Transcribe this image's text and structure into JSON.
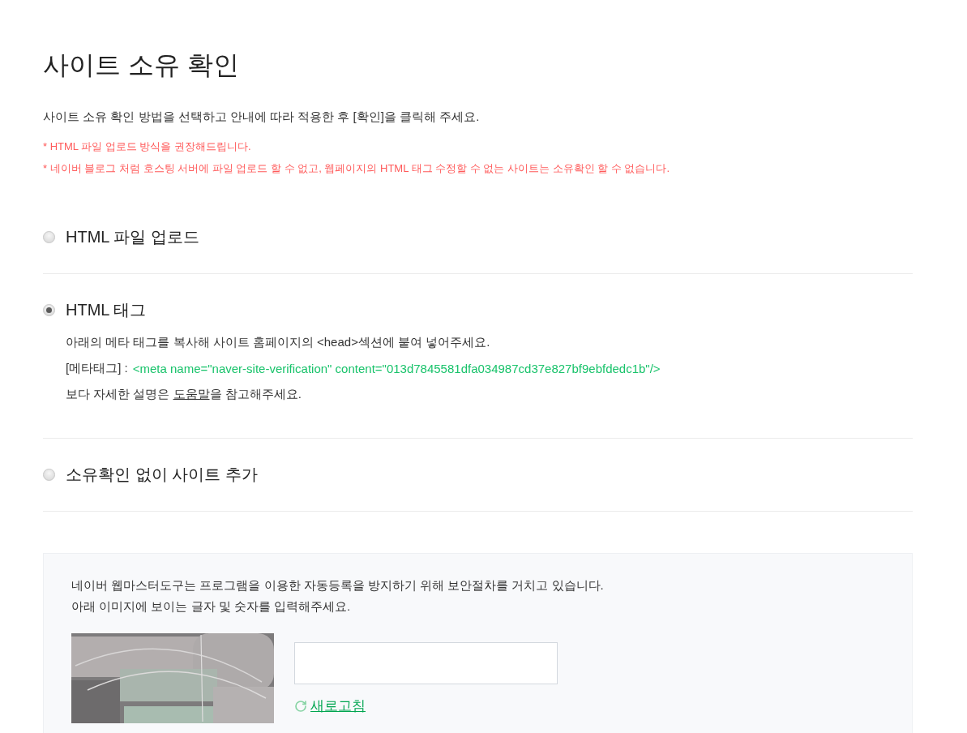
{
  "page": {
    "title": "사이트 소유 확인",
    "description": "사이트 소유 확인 방법을 선택하고 안내에 따라 적용한 후 [확인]을 클릭해 주세요.",
    "notes": [
      "* HTML 파일 업로드 방식을 권장해드립니다.",
      "* 네이버 블로그 처럼 호스팅 서버에 파일 업로드 할 수 없고, 웹페이지의 HTML 태그 수정할 수 없는 사이트는 소유확인 할 수 없습니다."
    ]
  },
  "methods": [
    {
      "label": "HTML 파일 업로드",
      "selected": false
    },
    {
      "label": "HTML 태그",
      "selected": true,
      "details": [
        {
          "kind": "text",
          "text": "아래의 메타 태그를 복사해 사이트 홈페이지의 <head>섹션에 붙여 넣어주세요."
        },
        {
          "kind": "code",
          "label": "[메타태그] :",
          "code": "<meta name=\"naver-site-verification\" content=\"013d7845581dfa034987cd37e827bf9ebfdedc1b\"/>"
        },
        {
          "kind": "link",
          "before": "보다 자세한 설명은",
          "link": "도움말",
          "after": "을 참고해주세요."
        }
      ]
    },
    {
      "label": "소유확인 없이 사이트 추가",
      "selected": false
    }
  ],
  "captcha": {
    "messages": [
      "네이버 웹마스터도구는 프로그램을 이용한 자동등록을 방지하기 위해 보안절차를 거치고 있습니다.",
      "아래 이미지에 보이는 글자 및 숫자를 입력해주세요."
    ],
    "refresh_link": "새로고침"
  }
}
